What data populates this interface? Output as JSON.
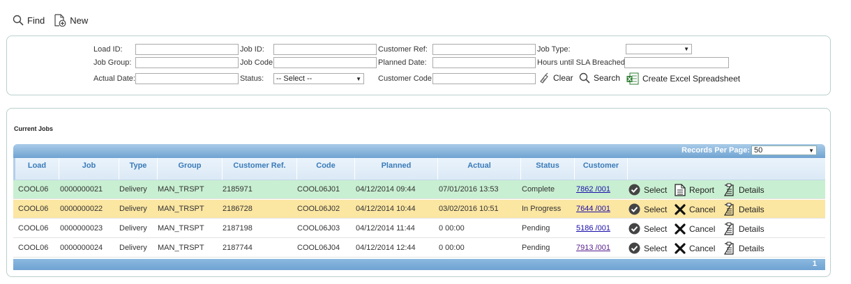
{
  "toolbar": {
    "find_label": "Find",
    "new_label": "New"
  },
  "filters": {
    "load_id": "Load ID:",
    "job_id": "Job ID:",
    "customer_ref": "Customer Ref:",
    "job_type": "Job Type:",
    "job_group": "Job Group:",
    "job_code": "Job Code",
    "planned_date": "Planned Date:",
    "hours_sla": "Hours until SLA Breached",
    "actual_date": "Actual Date:",
    "status": "Status:",
    "status_value": "-- Select --",
    "customer_code": "Customer Code",
    "clear_label": "Clear",
    "search_label": "Search",
    "excel_label": "Create Excel Spreadsheet"
  },
  "jobs": {
    "title": "Current Jobs",
    "records_per_page_label": "Records Per Page:",
    "records_per_page_value": "50",
    "columns": [
      "Load",
      "Job",
      "Type",
      "Group",
      "Customer Ref.",
      "Code",
      "Planned",
      "Actual",
      "Status",
      "Customer"
    ],
    "rows": [
      {
        "load": "COOL06",
        "job": "0000000021",
        "type": "Delivery",
        "group": "MAN_TRSPT",
        "customer_ref": "2185971",
        "code": "COOL06J01",
        "planned": "04/12/2014 09:44",
        "actual": "07/01/2016 13:53",
        "status": "Complete",
        "customer": "7862 /001",
        "actions": [
          "Select",
          "Report",
          "Details"
        ]
      },
      {
        "load": "COOL06",
        "job": "0000000022",
        "type": "Delivery",
        "group": "MAN_TRSPT",
        "customer_ref": "2186728",
        "code": "COOL06J02",
        "planned": "04/12/2014 10:44",
        "actual": "03/02/2016 10:51",
        "status": "In Progress",
        "customer": "7644 /001",
        "actions": [
          "Select",
          "Cancel",
          "Details"
        ]
      },
      {
        "load": "COOL06",
        "job": "0000000023",
        "type": "Delivery",
        "group": "MAN_TRSPT",
        "customer_ref": "2187198",
        "code": "COOL06J03",
        "planned": "04/12/2014 11:44",
        "actual": "0 00:00",
        "status": "Pending",
        "customer": "5186 /001",
        "actions": [
          "Select",
          "Cancel",
          "Details"
        ]
      },
      {
        "load": "COOL06",
        "job": "0000000024",
        "type": "Delivery",
        "group": "MAN_TRSPT",
        "customer_ref": "2187744",
        "code": "COOL06J04",
        "planned": "04/12/2014 12:44",
        "actual": "0 00:00",
        "status": "Pending",
        "customer": "7913 /001",
        "actions": [
          "Select",
          "Cancel",
          "Details"
        ]
      }
    ],
    "page": "1"
  },
  "colors": {
    "row_complete": "#c8efd1",
    "row_in_progress": "#fbe6a2",
    "header_blue": "#6fa3d2",
    "link": "#1a0dab",
    "visited_link": "#551a8b"
  }
}
